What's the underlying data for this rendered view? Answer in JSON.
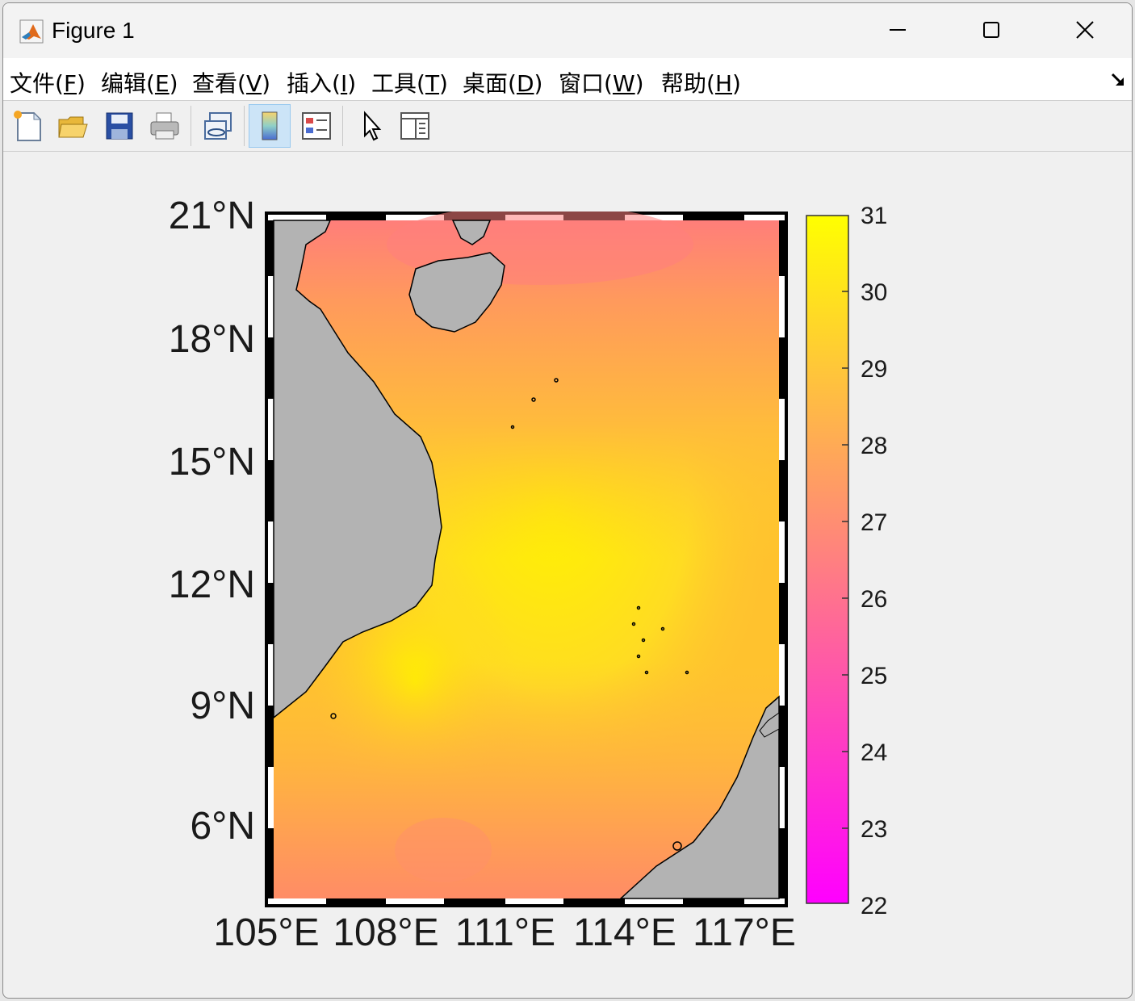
{
  "window": {
    "title": "Figure 1"
  },
  "menubar": {
    "items": [
      {
        "label": "文件(",
        "key": "F",
        "suffix": ")"
      },
      {
        "label": "编辑(",
        "key": "E",
        "suffix": ")"
      },
      {
        "label": "查看(",
        "key": "V",
        "suffix": ")"
      },
      {
        "label": "插入(",
        "key": "I",
        "suffix": ")"
      },
      {
        "label": "工具(",
        "key": "T",
        "suffix": ")"
      },
      {
        "label": "桌面(",
        "key": "D",
        "suffix": ")"
      },
      {
        "label": "窗口(",
        "key": "W",
        "suffix": ")"
      },
      {
        "label": "帮助(",
        "key": "H",
        "suffix": ")"
      }
    ]
  },
  "toolbar": {
    "tools": [
      "new-figure-icon",
      "open-file-icon",
      "save-icon",
      "print-icon",
      "link-plot-icon",
      "insert-colorbar-icon",
      "insert-legend-icon",
      "edit-plot-pointer-icon",
      "property-inspector-icon"
    ]
  },
  "chart_data": {
    "type": "heatmap",
    "xlabel": "",
    "ylabel": "",
    "x_ticks": [
      "105°E",
      "108°E",
      "111°E",
      "114°E",
      "117°E"
    ],
    "y_ticks": [
      "21°N",
      "18°N",
      "15°N",
      "12°N",
      "9°N",
      "6°N"
    ],
    "xlim": [
      105,
      117.7
    ],
    "ylim": [
      4.3,
      21
    ],
    "colorbar": {
      "ticks": [
        "31",
        "30",
        "29",
        "28",
        "27",
        "26",
        "25",
        "24",
        "23",
        "22"
      ],
      "range": [
        22,
        31
      ],
      "colormap": "spring"
    },
    "land_color": "#b3b3b3",
    "grid": false
  }
}
